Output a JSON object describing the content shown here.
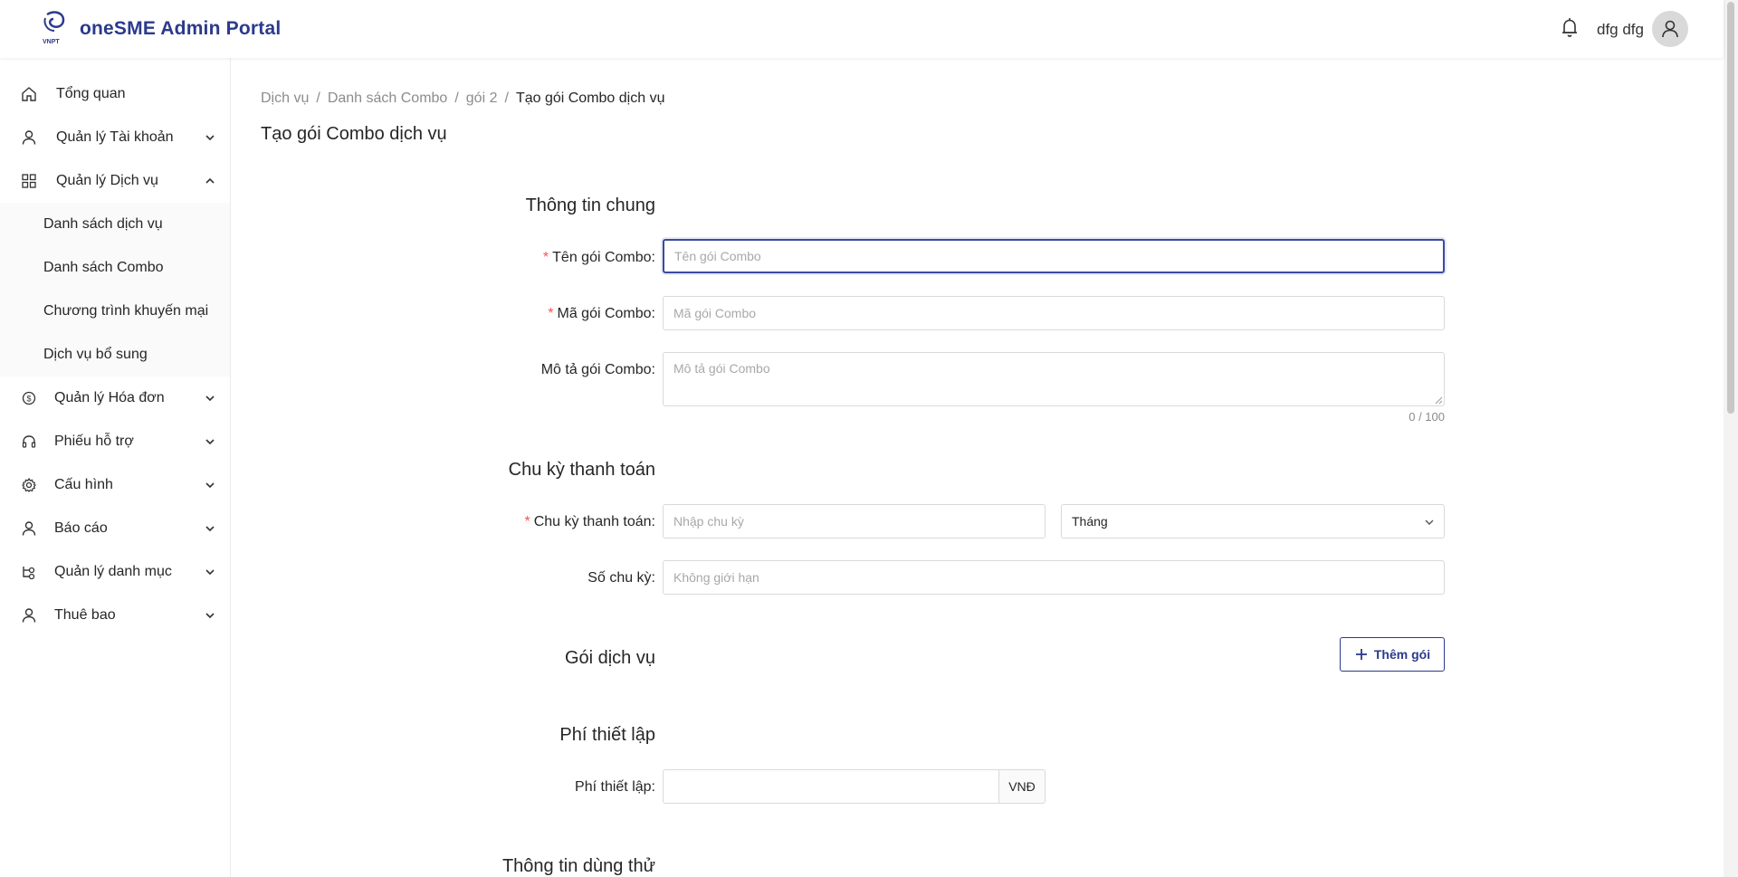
{
  "header": {
    "title": "oneSME Admin Portal",
    "logo_text": "VNPT",
    "user_name": "dfg dfg"
  },
  "sidebar": {
    "items": [
      {
        "label": "Tổng quan",
        "icon": "home-icon"
      },
      {
        "label": "Quản lý Tài khoản",
        "icon": "user-icon"
      },
      {
        "label": "Quản lý Dịch vụ",
        "icon": "grid-icon"
      },
      {
        "label": "Quản lý Hóa đơn",
        "icon": "dollar-icon"
      },
      {
        "label": "Phiếu hỗ trợ",
        "icon": "headset-icon"
      },
      {
        "label": "Cấu hình",
        "icon": "gear-icon"
      },
      {
        "label": "Báo cáo",
        "icon": "user-icon"
      },
      {
        "label": "Quản lý danh mục",
        "icon": "category-icon"
      },
      {
        "label": "Thuê bao",
        "icon": "user-icon"
      }
    ],
    "submenu": [
      {
        "label": "Danh sách dịch vụ"
      },
      {
        "label": "Danh sách Combo"
      },
      {
        "label": "Chương trình khuyến mại"
      },
      {
        "label": "Dịch vụ bổ sung"
      }
    ]
  },
  "breadcrumb": [
    "Dịch vụ",
    "Danh sách Combo",
    "gói 2",
    "Tạo gói Combo dịch vụ"
  ],
  "page_title": "Tạo gói Combo dịch vụ",
  "form": {
    "general": {
      "title": "Thông tin chung",
      "name_label": "Tên gói Combo:",
      "name_placeholder": "Tên gói Combo",
      "code_label": "Mã gói Combo:",
      "code_placeholder": "Mã gói Combo",
      "desc_label": "Mô tả gói Combo:",
      "desc_placeholder": "Mô tả gói Combo",
      "desc_counter": "0 / 100"
    },
    "billing": {
      "title": "Chu kỳ thanh toán",
      "cycle_label": "Chu kỳ thanh toán:",
      "cycle_placeholder": "Nhập chu kỳ",
      "unit_value": "Tháng",
      "count_label": "Số chu kỳ:",
      "count_placeholder": "Không giới hạn"
    },
    "services": {
      "title": "Gói dịch vụ",
      "add_button": "Thêm gói"
    },
    "setup_fee": {
      "title": "Phí thiết lập",
      "label": "Phí thiết lập:",
      "currency": "VNĐ"
    },
    "trial": {
      "title": "Thông tin dùng thử"
    }
  }
}
